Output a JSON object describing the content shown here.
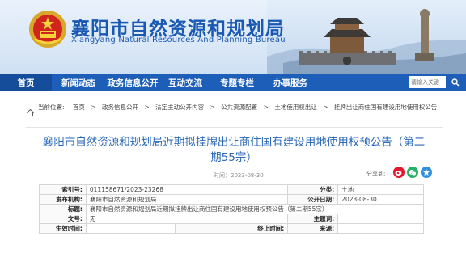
{
  "header": {
    "title_cn": "襄阳市自然资源和规划局",
    "title_en": "Xiangyang Natural Resources And Planning Bureau"
  },
  "nav": {
    "items": [
      "首页",
      "新闻动态",
      "政务信息公开",
      "互动交流",
      "专题专栏",
      "办事服务"
    ],
    "search_placeholder": "请输入关键"
  },
  "breadcrumb": {
    "prefix": "当前位置:",
    "items": [
      "首页",
      "政务信息公开",
      "法定主动公开内容",
      "公共资源配置",
      "土地使用权出让",
      "挂牌出让商住国有建设用地使用权公告"
    ]
  },
  "article": {
    "title": "襄阳市自然资源和规划局近期拟挂牌出让商住国有建设用地使用权预公告（第二期55宗）",
    "time_label": "时间：2023-08-30",
    "share_label": "分享到:"
  },
  "info": {
    "index_label": "索引号:",
    "index_value": "011158671/2023-23268",
    "category_label": "分类:",
    "category_value": "土地",
    "publisher_label": "发布机构:",
    "publisher_value": "襄阳市自然资源和规划局",
    "pubdate_label": "公开日期:",
    "pubdate_value": "2023-08-30",
    "subject_label": "标题:",
    "subject_value": "襄阳市自然资源和规划局近期拟挂牌出让商住国有建设用地使用权预公告（第二期55宗）",
    "docno_label": "文号:",
    "docno_value": "无",
    "keywords_label": "主题词:",
    "keywords_value": "",
    "effective_label": "生效时间:",
    "effective_value": "",
    "expire_label": "终止时间:",
    "expire_value": "",
    "source_label": "来源:",
    "source_value": ""
  },
  "colors": {
    "brand_blue": "#1d5fb8",
    "title_blue": "#2a68b8",
    "weibo": "#e6162d",
    "wechat": "#2aae67",
    "qzone": "#2f8fe0"
  }
}
